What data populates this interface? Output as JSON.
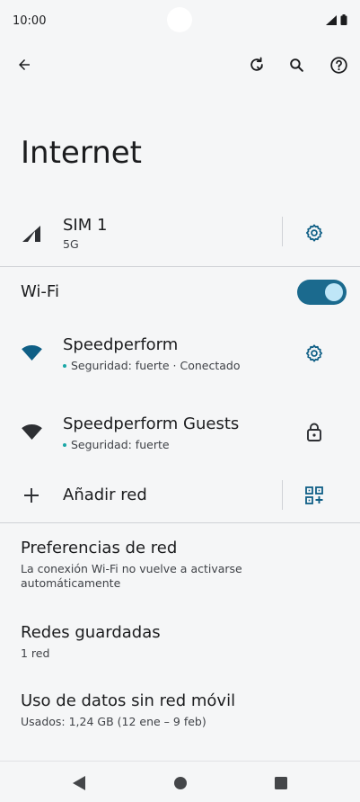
{
  "status": {
    "time": "10:00"
  },
  "page": {
    "title": "Internet"
  },
  "sim": {
    "name": "SIM 1",
    "network": "5G"
  },
  "wifi": {
    "label": "Wi-Fi",
    "enabled": true
  },
  "networks": [
    {
      "name": "Speedperform",
      "status": "Seguridad: fuerte · Conectado"
    },
    {
      "name": "Speedperform Guests",
      "status": "Seguridad: fuerte"
    }
  ],
  "add_network": {
    "label": "Añadir red"
  },
  "preferences": {
    "title": "Preferencias de red",
    "subtitle": "La conexión Wi-Fi no vuelve a activarse automáticamente"
  },
  "saved": {
    "title": "Redes guardadas",
    "subtitle": "1 red"
  },
  "data_usage": {
    "title": "Uso de datos sin red móvil",
    "subtitle": "Usados: 1,24 GB (12 ene – 9 feb)"
  },
  "colors": {
    "accent": "#1b6a8e",
    "toggle_knob": "#bfe6f7",
    "wifi_icon": "#0f5f86",
    "background": "#f5f6f7"
  }
}
